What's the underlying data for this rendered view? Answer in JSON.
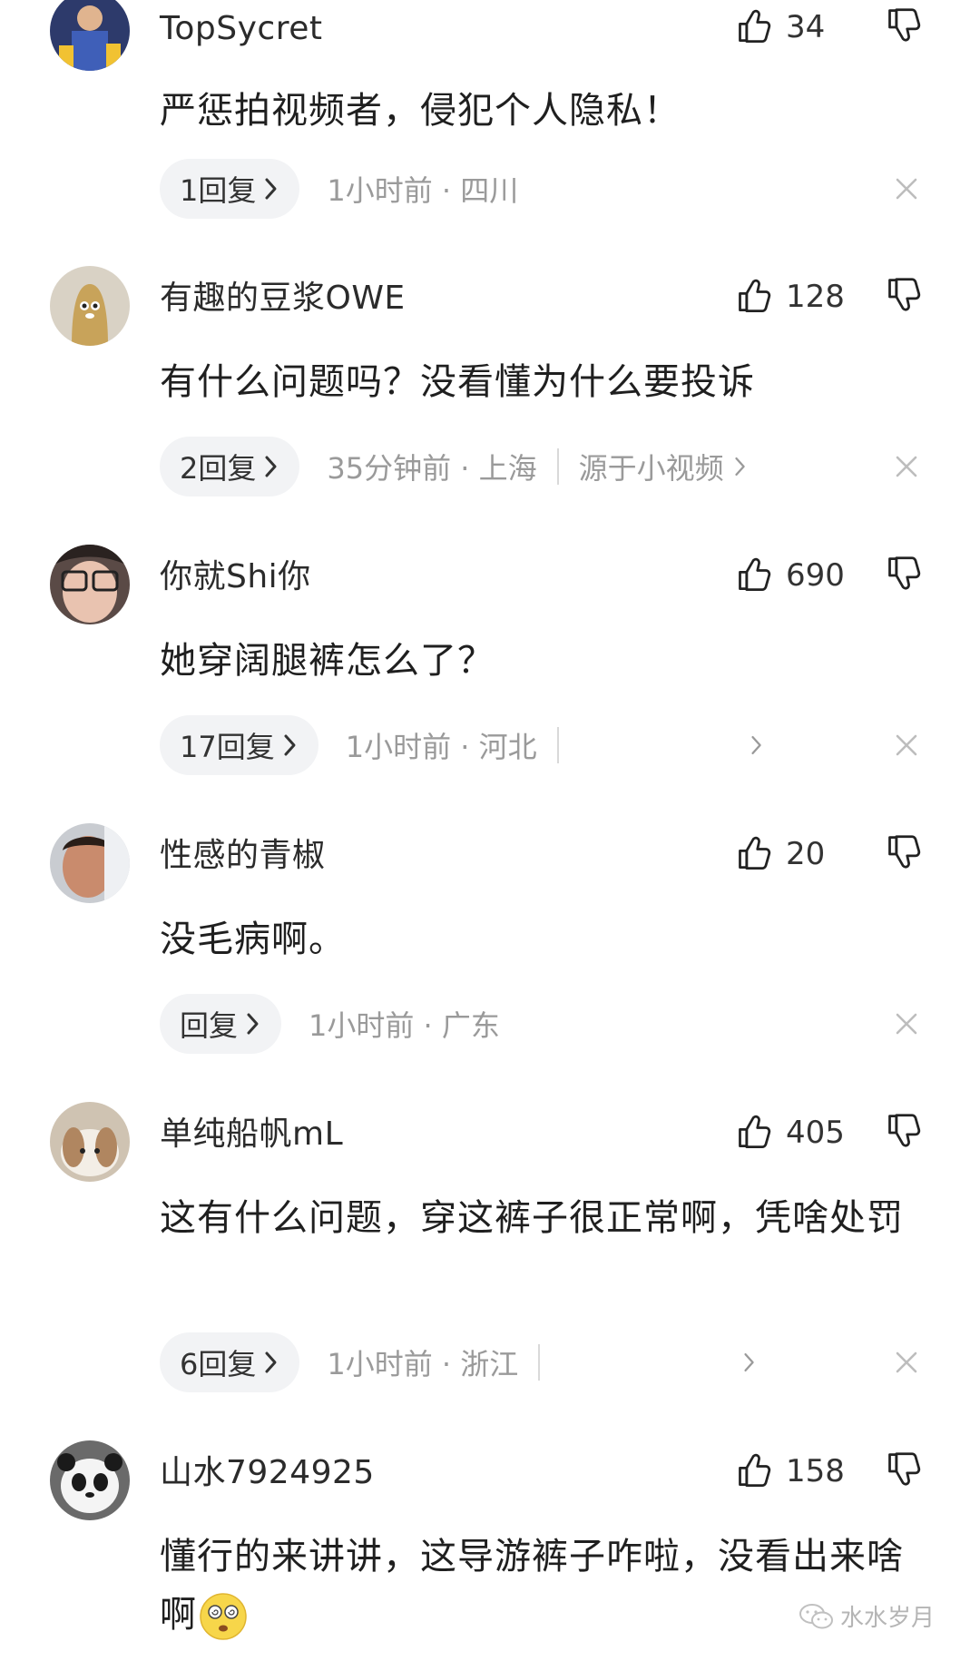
{
  "comments": [
    {
      "username": "TopSycret",
      "likes": "34",
      "text": "严惩拍视频者，侵犯个人隐私！",
      "reply_label": "1回复",
      "meta": "1小时前 · 四川"
    },
    {
      "username": "有趣的豆浆OWE",
      "likes": "128",
      "text": "有什么问题吗？没看懂为什么要投诉",
      "reply_label": "2回复",
      "meta": "35分钟前 · 上海",
      "source": "源于小视频"
    },
    {
      "username": "你就Shi你",
      "likes": "690",
      "text": "她穿阔腿裤怎么了？",
      "reply_label": "17回复",
      "meta": "1小时前 · 河北"
    },
    {
      "username": "性感的青椒",
      "likes": "20",
      "text": "没毛病啊。",
      "reply_label": "回复",
      "meta": "1小时前 · 广东"
    },
    {
      "username": "单纯船帆mL",
      "likes": "405",
      "text": "这有什么问题，穿这裤子很正常啊，凭啥处罚",
      "reply_label": "6回复",
      "meta": "1小时前 · 浙江"
    },
    {
      "username": "山水7924925",
      "likes": "158",
      "text": "懂行的来讲讲，这导游裤子咋啦，没看出来啥啊"
    }
  ],
  "icons": {
    "like": "thumbs-up-icon",
    "dislike": "thumbs-down-icon",
    "close": "close-icon",
    "chevron": "chevron-right-icon",
    "emoji": "dizzy-face-emoji"
  },
  "watermark": {
    "text": "水水岁月"
  },
  "colors": {
    "text_primary": "#1f1f1f",
    "text_secondary": "#9a9a9a",
    "pill_bg": "#f2f3f5"
  }
}
